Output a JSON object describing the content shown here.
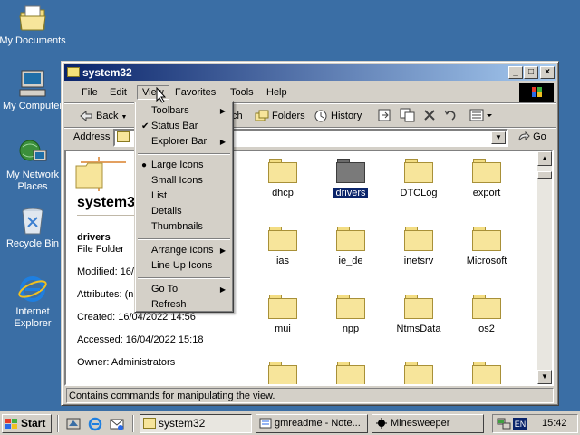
{
  "desktop": {
    "icons": [
      {
        "label": "My Documents"
      },
      {
        "label": "My Computer"
      },
      {
        "label": "My Network Places"
      },
      {
        "label": "Recycle Bin"
      },
      {
        "label": "Internet Explorer"
      }
    ]
  },
  "window": {
    "title": "system32",
    "menu": [
      "File",
      "Edit",
      "View",
      "Favorites",
      "Tools",
      "Help"
    ],
    "toolbar": {
      "back": "Back",
      "search_partial": "ch",
      "folders": "Folders",
      "history": "History"
    },
    "address_label": "Address",
    "go_label": "Go",
    "left_pane": {
      "folder_title": "system3",
      "selected_name": "drivers",
      "selected_type": "File Folder",
      "modified": "Modified: 16/",
      "attributes": "Attributes: (n",
      "created": "Created: 16/04/2022 14:56",
      "accessed": "Accessed: 16/04/2022 15:18",
      "owner": "Owner: Administrators"
    },
    "folders": [
      "dhcp",
      "drivers",
      "DTCLog",
      "export",
      "ias",
      "ie_de",
      "inetsrv",
      "Microsoft",
      "mui",
      "npp",
      "NtmsData",
      "os2"
    ],
    "status": "Contains commands for manipulating the view."
  },
  "view_menu": {
    "items": [
      "Toolbars",
      "Status Bar",
      "Explorer Bar",
      "Large Icons",
      "Small Icons",
      "List",
      "Details",
      "Thumbnails",
      "Arrange Icons",
      "Line Up Icons",
      "Go To",
      "Refresh"
    ]
  },
  "taskbar": {
    "start": "Start",
    "tasks": [
      "system32",
      "gmreadme - Note...",
      "Minesweeper"
    ],
    "lang": "EN",
    "clock": "15:42"
  },
  "colors": {
    "desktop": "#3a6ea5",
    "titlebar_start": "#0a246a",
    "titlebar_end": "#a6caf0",
    "face": "#d4d0c8",
    "selection": "#0a246a"
  }
}
